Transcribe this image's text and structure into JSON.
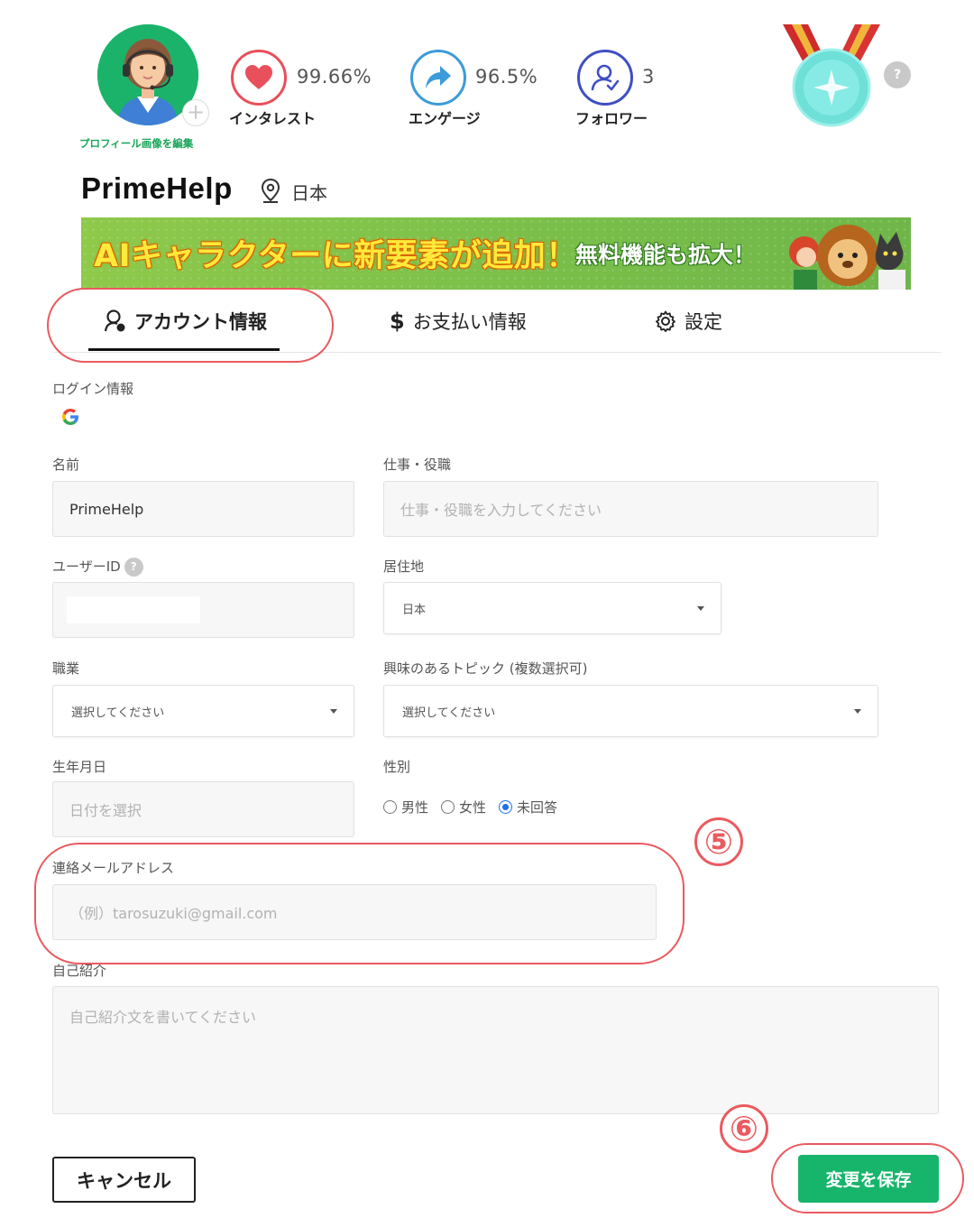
{
  "profile": {
    "edit_avatar_label": "プロフィール画像を編集",
    "username": "PrimeHelp",
    "location": "日本"
  },
  "stats": [
    {
      "value": "99.66%",
      "label": "インタレスト",
      "icon": "heart-icon",
      "color": "#e8505b"
    },
    {
      "value": "96.5%",
      "label": "エンゲージ",
      "icon": "share-arrow-icon",
      "color": "#3c9bd8"
    },
    {
      "value": "3",
      "label": "フォロワー",
      "icon": "follower-icon",
      "color": "#3f4fc4"
    }
  ],
  "badge": {
    "help": "?"
  },
  "banner": {
    "main_text": "AIキャラクターに新要素が追加！",
    "sub_text": "無料機能も拡大！"
  },
  "tabs": [
    {
      "label": "アカウント情報",
      "icon": "account-icon",
      "active": true
    },
    {
      "label": "お支払い情報",
      "icon": "dollar-icon",
      "active": false
    },
    {
      "label": "設定",
      "icon": "gear-icon",
      "active": false
    }
  ],
  "form": {
    "login_label": "ログイン情報",
    "login_provider_icon": "google-icon",
    "name_label": "名前",
    "name_value": "PrimeHelp",
    "job_label": "仕事・役職",
    "job_placeholder": "仕事・役職を入力してください",
    "user_id_label": "ユーザーID",
    "user_id_help": "?",
    "residence_label": "居住地",
    "residence_value": "日本",
    "occupation_label": "職業",
    "occupation_value": "選択してください",
    "topics_label": "興味のあるトピック (複数選択可)",
    "topics_value": "選択してください",
    "birthday_label": "生年月日",
    "birthday_placeholder": "日付を選択",
    "gender_label": "性別",
    "gender_options": [
      "男性",
      "女性",
      "未回答"
    ],
    "gender_selected": "未回答",
    "email_label": "連絡メールアドレス",
    "email_placeholder": "（例）tarosuzuki@gmail.com",
    "bio_label": "自己紹介",
    "bio_placeholder": "自己紹介文を書いてください"
  },
  "actions": {
    "cancel_label": "キャンセル",
    "save_label": "変更を保存"
  },
  "annotations": {
    "step_email": "⑤",
    "step_save": "⑥",
    "highlight_color": "#ea5a5f"
  },
  "colors": {
    "accent_green": "#17b56b",
    "radio_blue": "#1a73e8"
  }
}
